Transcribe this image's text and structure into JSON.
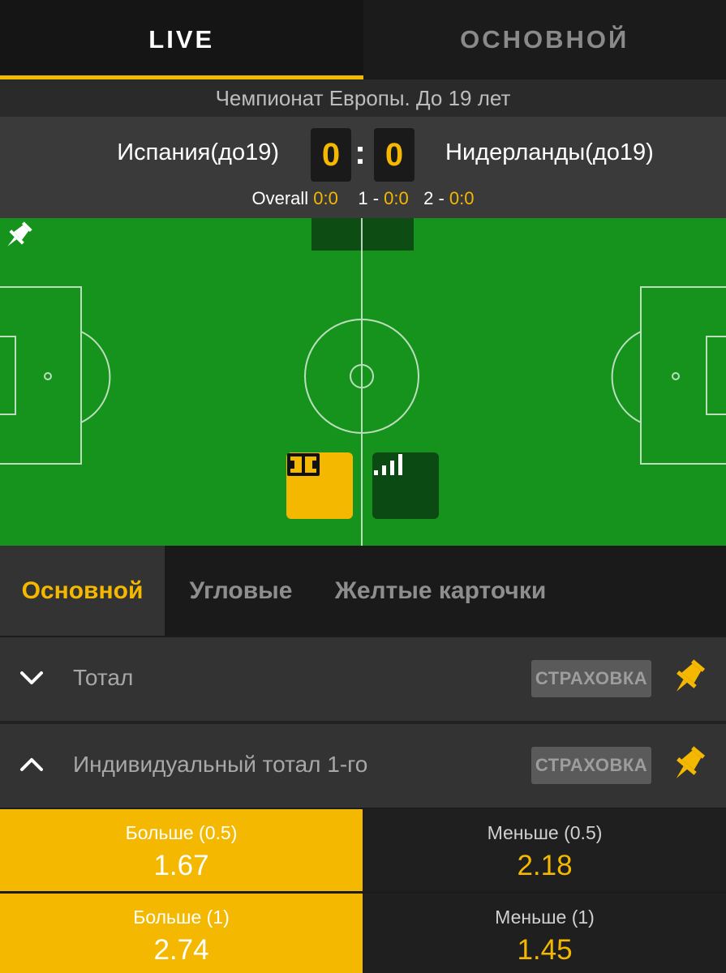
{
  "top_tabs": {
    "live": "LIVE",
    "main": "ОСНОВНОЙ"
  },
  "league": "Чемпионат Европы. До 19 лет",
  "match": {
    "home_team": "Испания(до19)",
    "away_team": "Нидерланды(до19)",
    "home_score": "0",
    "away_score": "0",
    "colon": ":",
    "overall_label": "Overall",
    "overall_score": "0:0",
    "p1_label": "1 -",
    "p1_score": "0:0",
    "p2_label": "2 -",
    "p2_score": "0:0"
  },
  "field": {
    "views": [
      "field-view-icon",
      "stats-bars-icon"
    ],
    "pin": "pin-icon"
  },
  "market_tabs": [
    "Основной",
    "Угловые",
    "Желтые карточки"
  ],
  "markets": [
    {
      "title": "Тотал",
      "insurance": "СТРАХОВКА",
      "expanded": false
    },
    {
      "title": "Индивидуальный тотал 1-го",
      "insurance": "СТРАХОВКА",
      "expanded": true
    }
  ],
  "odds": [
    {
      "over_label": "Больше (0.5)",
      "over_value": "1.67",
      "under_label": "Меньше (0.5)",
      "under_value": "2.18"
    },
    {
      "over_label": "Больше (1)",
      "over_value": "2.74",
      "under_label": "Меньше (1)",
      "under_value": "1.45"
    }
  ],
  "colors": {
    "accent": "#f5b800",
    "pitch": "#16931d",
    "bg": "#1c1c1c"
  }
}
